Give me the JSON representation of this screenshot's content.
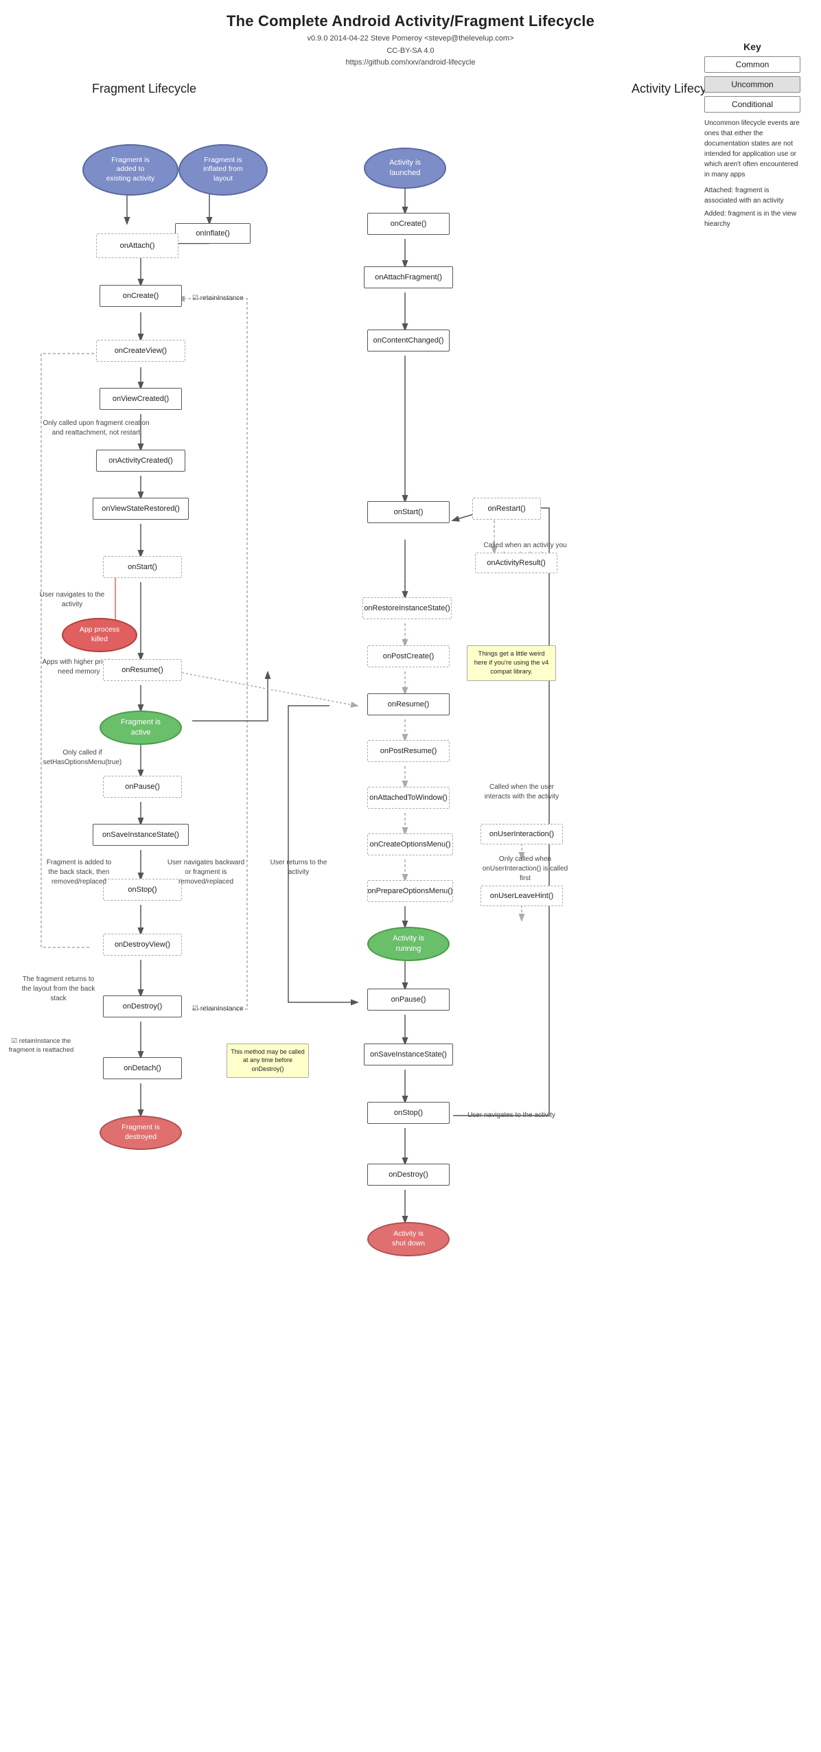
{
  "page": {
    "title": "The Complete Android Activity/Fragment Lifecycle",
    "subtitle_line1": "v0.9.0 2014-04-22 Steve Pomeroy <stevep@thelevelup.com>",
    "subtitle_line2": "CC-BY-SA 4.0",
    "subtitle_line3": "https://github.com/xxv/android-lifecycle"
  },
  "key": {
    "title": "Key",
    "common_label": "Common",
    "uncommon_label": "Uncommon",
    "conditional_label": "Conditional",
    "desc_attached": "Attached: fragment is associated with an activity",
    "desc_added": "Added: fragment is in the view hiearchy",
    "desc_uncommon": "Uncommon lifecycle events are ones that either the documentation states are not intended for application use or which aren't often encountered in many apps"
  },
  "sections": {
    "fragment": "Fragment Lifecycle",
    "activity": "Activity Lifecycle"
  },
  "nodes": {
    "fragment_added": "Fragment is\nadded to\nexisting activity",
    "fragment_inflated": "Fragment is\ninflated from\nlayout",
    "on_inflate": "onInflate()",
    "on_attach": "onAttach()",
    "on_create_fragment": "onCreate()",
    "retain_instance_1": "☑ retainInstance",
    "on_create_view": "onCreateView()",
    "on_view_created": "onViewCreated()",
    "on_activity_created": "onActivityCreated()",
    "on_view_state_restored": "onViewStateRestored()",
    "on_start_fragment": "onStart()",
    "on_resume_fragment": "onResume()",
    "fragment_is_active": "Fragment is\nactive",
    "on_pause_fragment": "onPause()",
    "on_save_instance_fragment": "onSaveInstanceState()",
    "on_stop_fragment": "onStop()",
    "on_destroy_view": "onDestroyView()",
    "on_destroy_fragment": "onDestroy()",
    "retain_instance_2": "☑ retainInstance",
    "on_detach": "onDetach()",
    "fragment_destroyed": "Fragment is\ndestroyed",
    "activity_launched": "Activity is\nlaunched",
    "on_create_activity": "onCreate()",
    "on_attach_fragment": "onAttachFragment()",
    "on_content_changed": "onContentChanged()",
    "on_restart": "onRestart()",
    "on_start_activity": "onStart()",
    "on_activity_result": "onActivityResult()",
    "on_restore_instance": "onRestoreInstanceState()",
    "on_post_create": "onPostCreate()",
    "on_resume_activity": "onResume()",
    "on_post_resume": "onPostResume()",
    "on_attached_to_window": "onAttachedToWindow()",
    "on_create_options_menu": "onCreateOptionsMenu()",
    "on_prepare_options_menu": "onPrepareOptionsMenu()",
    "activity_is_running": "Activity is\nrunning",
    "on_user_interaction": "onUserInteraction()",
    "on_user_leave_hint": "onUserLeaveHint()",
    "on_pause_activity": "onPause()",
    "on_save_instance_activity": "onSaveInstanceState()",
    "on_stop_activity": "onStop()",
    "on_destroy_activity": "onDestroy()",
    "activity_shut_down": "Activity is\nshut down",
    "app_process_killed": "App process\nkilled"
  },
  "labels": {
    "only_called_creation": "Only called upon fragment creation\nand reattachment, not restart",
    "only_called_set_has": "Only called if\nsetHasOptionsMenu(true)",
    "fragment_added_back": "Fragment is\nadded to the back\nstack, then\nremoved/replaced",
    "user_navigates_backward": "User navigates\nbackward or\nfragment is\nremoved/replaced",
    "user_navigates_activity": "User navigates\nto the activity",
    "apps_higher_priority": "Apps with higher priority\nneed memory",
    "fragment_returns_layout": "The fragment\nreturns to the\nlayout from the\nback stack",
    "retain_reattached": "☑ retainInstance\nthe fragment is\nreattached",
    "user_returns_activity": "User returns\nto the activity",
    "called_when_activity_exits": "Called when an activity\nyou launched exits",
    "things_get_weird": "Things get a little\nweird here if you're\nusing the v4 compat\nlibrary.",
    "called_when_user_interacts": "Called when the user\ninteracts with the\nactivity",
    "only_called_on_user": "Only called when\nonUserInteraction() is called first",
    "this_method_may": "This method\nmay be called at\nany time before\nonDestroy()",
    "user_navigates_to_activity2": "User navigates\nto the activity"
  }
}
